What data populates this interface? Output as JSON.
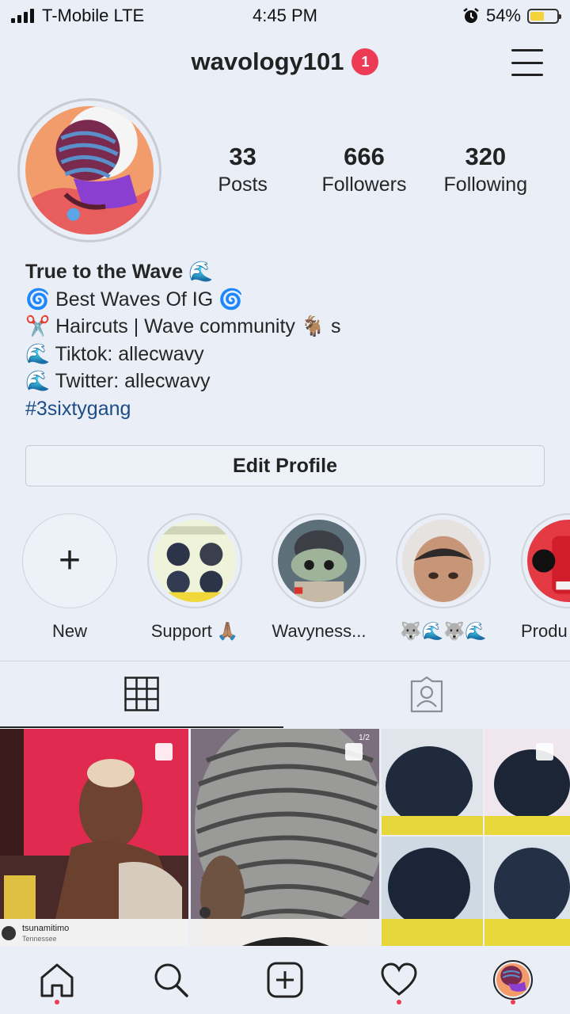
{
  "status_bar": {
    "carrier": "T-Mobile LTE",
    "time": "4:45 PM",
    "battery_percent": "54%",
    "battery_level": 0.54,
    "icons": [
      "signal-icon",
      "alarm-icon",
      "battery-charging-icon"
    ]
  },
  "header": {
    "username": "wavology101",
    "notification_count": "1",
    "menu_icon": "hamburger-menu-icon"
  },
  "stats": [
    {
      "value": "33",
      "label": "Posts"
    },
    {
      "value": "666",
      "label": "Followers"
    },
    {
      "value": "320",
      "label": "Following"
    }
  ],
  "bio": {
    "name": "True to the Wave 🌊",
    "lines": [
      "🌀 Best Waves Of IG 🌀",
      "✂️ Haircuts | Wave community 🐐 s",
      "🌊 Tiktok: allecwavy",
      "🌊 Twitter: allecwavy"
    ],
    "hashtag": "#3sixtygang"
  },
  "edit_profile_label": "Edit Profile",
  "highlights": [
    {
      "label": "New",
      "icon": "plus-icon"
    },
    {
      "label": "Support 🙏🏽"
    },
    {
      "label": "Wavyness..."
    },
    {
      "label": "🐺🌊🐺🌊"
    },
    {
      "label": "Produ"
    }
  ],
  "tabs": [
    {
      "icon": "grid-icon",
      "active": true
    },
    {
      "icon": "tagged-person-icon",
      "active": false
    }
  ],
  "grid_posts": [
    {
      "caption": "tsunamitimo",
      "subcaption": "Tennessee"
    },
    {
      "caption": "1/2"
    },
    {
      "caption": ""
    }
  ],
  "bottom_nav": [
    {
      "icon": "home-icon",
      "has_dot": true
    },
    {
      "icon": "search-icon",
      "has_dot": false
    },
    {
      "icon": "new-post-icon",
      "has_dot": false
    },
    {
      "icon": "heart-icon",
      "has_dot": true
    },
    {
      "icon": "profile-avatar-icon",
      "has_dot": true
    }
  ],
  "colors": {
    "background": "#e9eef7",
    "badge": "#ed3b55",
    "hashtag": "#1d4c86"
  }
}
